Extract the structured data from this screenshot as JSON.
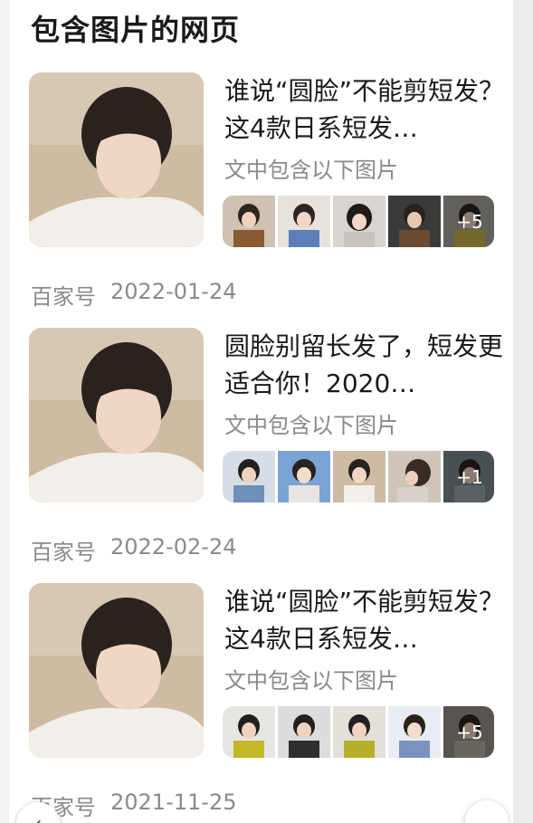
{
  "section": {
    "title": "包含图片的网页"
  },
  "cards": [
    {
      "headline": "谁说“圆脸”不能剪短发？这4款日系短发…",
      "subline": "文中包含以下图片",
      "more_count": "+5",
      "source": "百家号",
      "date": "2022-01-24",
      "tile_colors": [
        "#8a5a33",
        "#5b7fb8",
        "#c8c3bd",
        "#6a4a30",
        "#a9a6a0"
      ]
    },
    {
      "headline": "圆脸别留长发了，短发更适合你！2020…",
      "subline": "文中包含以下图片",
      "more_count": "+1",
      "source": "百家号",
      "date": "2022-02-24",
      "tile_colors": [
        "#6d8fb8",
        "#e9e4df",
        "#a58a72",
        "#cfc4b8",
        "#7d8a90"
      ]
    },
    {
      "headline": "谁说“圆脸”不能剪短发？这4款日系短发…",
      "subline": "文中包含以下图片",
      "more_count": "+5",
      "source": "百家号",
      "date": "2021-11-25",
      "tile_colors": [
        "#c2b828",
        "#2e2e2e",
        "#b7b02a",
        "#7a92c0",
        "#9a9288"
      ]
    }
  ],
  "nav": {
    "prev_icon": "‹",
    "more_icon": "…"
  }
}
